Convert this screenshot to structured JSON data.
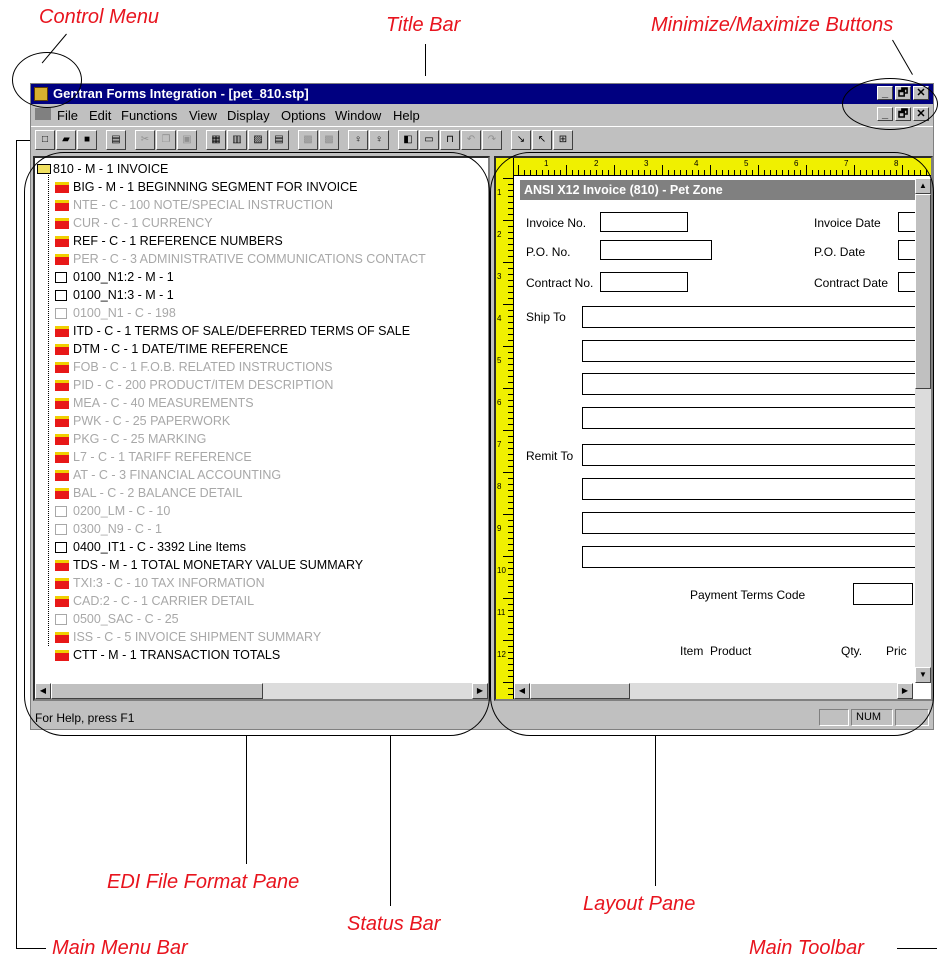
{
  "callouts": {
    "control_menu": "Control Menu",
    "title_bar": "Title Bar",
    "minmax": "Minimize/Maximize Buttons",
    "edi_pane": "EDI File Format Pane",
    "status_bar": "Status Bar",
    "layout_pane": "Layout Pane",
    "main_menu_bar": "Main Menu Bar",
    "main_toolbar": "Main Toolbar"
  },
  "window": {
    "title": "Gentran Forms Integration - [pet_810.stp]",
    "buttons": [
      "_",
      "🗗",
      "✕"
    ]
  },
  "menu": [
    "File",
    "Edit",
    "Functions",
    "View",
    "Display",
    "Options",
    "Window",
    "Help"
  ],
  "tree": {
    "root": "810 - M - 1 INVOICE",
    "items": [
      {
        "label": "BIG - M - 1 BEGINNING SEGMENT FOR INVOICE",
        "kind": "seg",
        "enabled": true
      },
      {
        "label": "NTE - C - 100 NOTE/SPECIAL INSTRUCTION",
        "kind": "seg",
        "enabled": false
      },
      {
        "label": "CUR - C - 1 CURRENCY",
        "kind": "seg",
        "enabled": false
      },
      {
        "label": "REF - C - 1 REFERENCE NUMBERS",
        "kind": "seg",
        "enabled": true
      },
      {
        "label": "PER - C - 3 ADMINISTRATIVE COMMUNICATIONS CONTACT",
        "kind": "seg",
        "enabled": false
      },
      {
        "label": "0100_N1:2 - M - 1",
        "kind": "grp",
        "enabled": true
      },
      {
        "label": "0100_N1:3 - M - 1",
        "kind": "grp",
        "enabled": true
      },
      {
        "label": "0100_N1 - C - 198",
        "kind": "grp",
        "enabled": false
      },
      {
        "label": "ITD - C - 1 TERMS OF SALE/DEFERRED TERMS OF SALE",
        "kind": "seg",
        "enabled": true
      },
      {
        "label": "DTM - C - 1 DATE/TIME REFERENCE",
        "kind": "seg",
        "enabled": true
      },
      {
        "label": "FOB - C - 1 F.O.B. RELATED INSTRUCTIONS",
        "kind": "seg",
        "enabled": false
      },
      {
        "label": "PID - C - 200 PRODUCT/ITEM DESCRIPTION",
        "kind": "seg",
        "enabled": false
      },
      {
        "label": "MEA - C - 40 MEASUREMENTS",
        "kind": "seg",
        "enabled": false
      },
      {
        "label": "PWK - C - 25 PAPERWORK",
        "kind": "seg",
        "enabled": false
      },
      {
        "label": "PKG - C - 25 MARKING",
        "kind": "seg",
        "enabled": false
      },
      {
        "label": "L7 - C - 1 TARIFF REFERENCE",
        "kind": "seg",
        "enabled": false
      },
      {
        "label": "AT - C - 3 FINANCIAL ACCOUNTING",
        "kind": "seg",
        "enabled": false
      },
      {
        "label": "BAL - C - 2 BALANCE DETAIL",
        "kind": "seg",
        "enabled": false
      },
      {
        "label": "0200_LM - C - 10",
        "kind": "grp",
        "enabled": false
      },
      {
        "label": "0300_N9 - C - 1",
        "kind": "grp",
        "enabled": false
      },
      {
        "label": "0400_IT1 - C - 3392 Line Items",
        "kind": "grp",
        "enabled": true
      },
      {
        "label": "TDS - M - 1 TOTAL MONETARY VALUE SUMMARY",
        "kind": "seg",
        "enabled": true
      },
      {
        "label": "TXI:3 - C - 10 TAX INFORMATION",
        "kind": "seg",
        "enabled": false
      },
      {
        "label": "CAD:2 - C - 1 CARRIER DETAIL",
        "kind": "seg",
        "enabled": false
      },
      {
        "label": "0500_SAC - C - 25",
        "kind": "grp",
        "enabled": false
      },
      {
        "label": "ISS - C - 5 INVOICE SHIPMENT SUMMARY",
        "kind": "seg",
        "enabled": false
      },
      {
        "label": "CTT - M - 1 TRANSACTION TOTALS",
        "kind": "seg",
        "enabled": true
      }
    ]
  },
  "form": {
    "title": "ANSI X12 Invoice (810) - Pet Zone",
    "invoice_no": "Invoice No.",
    "invoice_date": "Invoice Date",
    "po_no": "P.O. No.",
    "po_date": "P.O. Date",
    "contract_no": "Contract No.",
    "contract_date": "Contract Date",
    "ship_to": "Ship To",
    "remit_to": "Remit To",
    "payment_terms": "Payment Terms Code",
    "col_item": "Item",
    "col_product": "Product",
    "col_qty": "Qty.",
    "col_price": "Pric"
  },
  "ruler": {
    "top": [
      "1",
      "2",
      "3",
      "4",
      "5",
      "6",
      "7",
      "8"
    ],
    "left": [
      "1",
      "2",
      "3",
      "4",
      "5",
      "6",
      "7",
      "8",
      "9",
      "10",
      "11",
      "12"
    ]
  },
  "status": {
    "help": "For Help, press F1",
    "num": "NUM"
  },
  "colors": {
    "titlebar": "#000080",
    "callout": "#e8141e",
    "ruler": "#f0f000",
    "segment": "#e81818"
  }
}
